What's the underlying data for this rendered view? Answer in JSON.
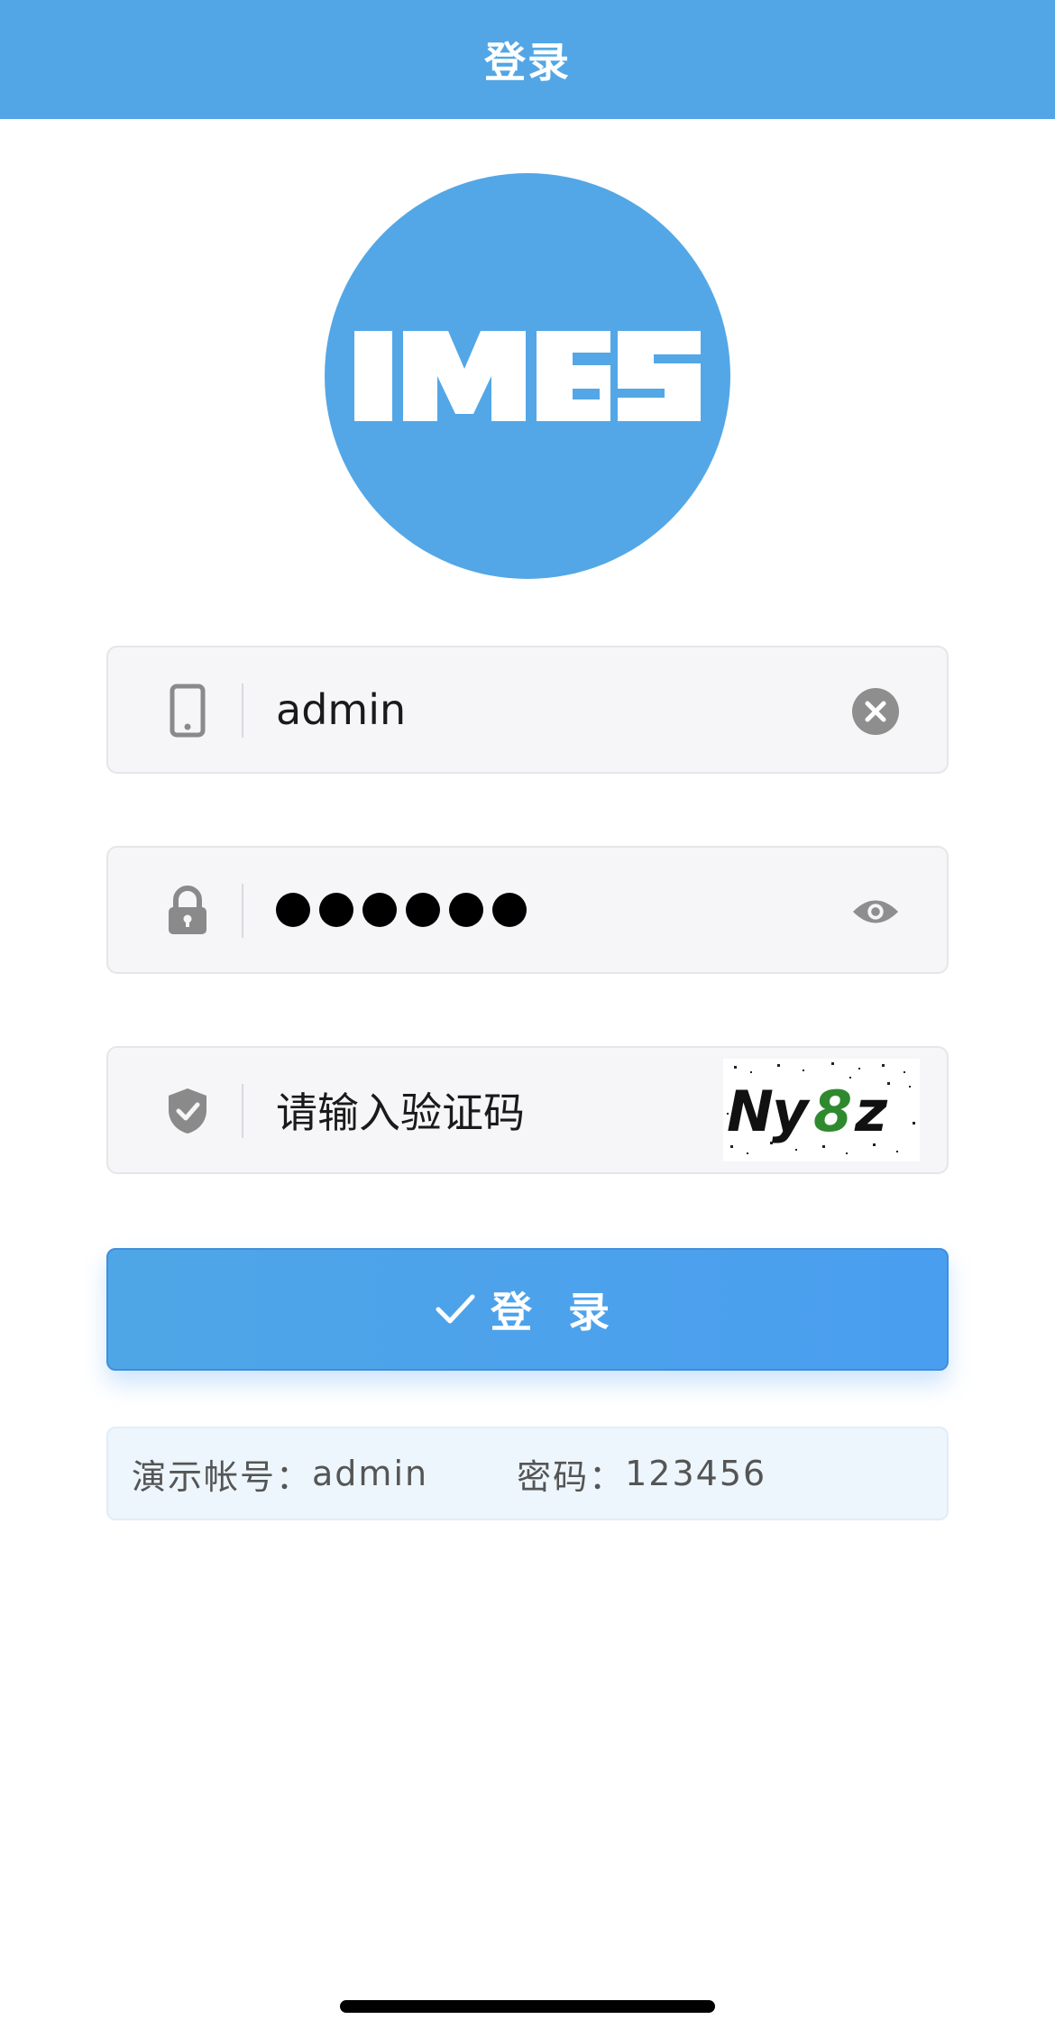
{
  "header": {
    "title": "登录"
  },
  "logo": {
    "text": "IMES",
    "bg_color": "#53a7e6"
  },
  "form": {
    "username": {
      "value": "admin",
      "icon": "phone-icon",
      "action_icon": "clear-icon"
    },
    "password": {
      "masked_length": 6,
      "icon": "lock-icon",
      "action_icon": "eye-icon"
    },
    "captcha": {
      "placeholder": "请输入验证码",
      "icon": "shield-check-icon",
      "image_text": "Ny8z"
    }
  },
  "login_button": {
    "label": "登 录",
    "icon": "check-icon"
  },
  "demo": {
    "account_label": "演示帐号：",
    "account_value": "admin",
    "password_label": "密码：",
    "password_value": "123456"
  },
  "colors": {
    "header": "#52a6e5",
    "button": "#4a9ef0",
    "field_bg": "#f6f6f9",
    "demo_bg": "#edf6fd"
  }
}
